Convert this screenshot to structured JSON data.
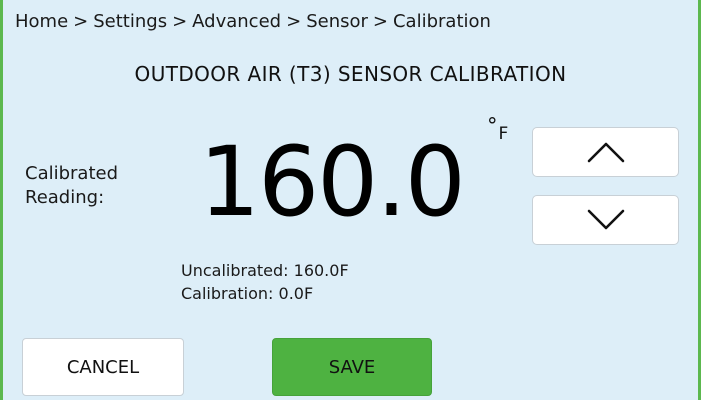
{
  "breadcrumb": {
    "items": [
      "Home",
      "Settings",
      "Advanced",
      "Sensor",
      "Calibration"
    ],
    "separator": ">"
  },
  "title": "OUTDOOR AIR (T3) SENSOR CALIBRATION",
  "reading": {
    "label_line1": "Calibrated",
    "label_line2": "Reading:",
    "value": "160.0",
    "unit_degree": "°",
    "unit_letter": "F"
  },
  "controls": {
    "up_icon": "chevron-up-icon",
    "down_icon": "chevron-down-icon"
  },
  "info": {
    "uncalibrated": "Uncalibrated: 160.0F",
    "calibration": "Calibration: 0.0F"
  },
  "actions": {
    "cancel_label": "CANCEL",
    "save_label": "SAVE"
  },
  "colors": {
    "background": "#ddeef8",
    "accent_green": "#4eb241",
    "border_green": "#5cb84f",
    "button_white": "#ffffff"
  }
}
